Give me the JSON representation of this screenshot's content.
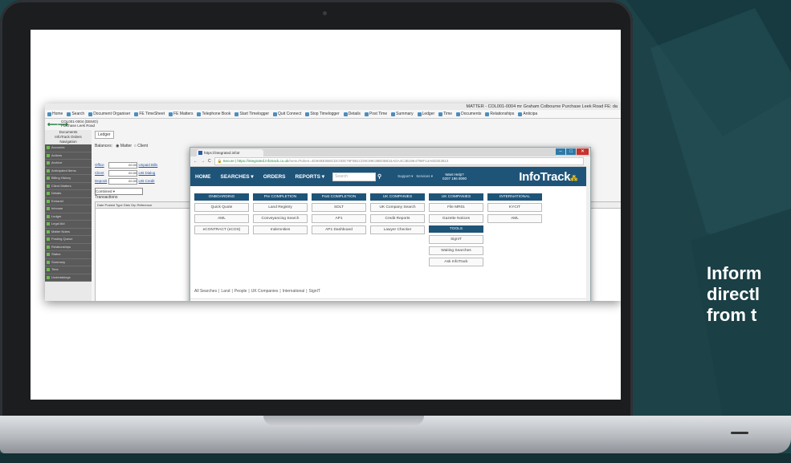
{
  "colors": {
    "background": "#1d4348",
    "infotrack_blue": "#1f5479",
    "laptop_bezel": "#1b1d1f"
  },
  "side_text": [
    "Inform",
    "directl",
    "from t"
  ],
  "app": {
    "title": "MATTER - COL001-0004 mr Graham Colbourne Purchase Leek Road FE: da",
    "toolbar": [
      "Home",
      "Search",
      "Document Organiser",
      "FE TimeSheet",
      "FE Matters",
      "Telephone Book",
      "Start Timelogger",
      "Quit Connect",
      "Stop Timelogger",
      "Details",
      "Post Time",
      "Summary",
      "Ledger",
      "Time",
      "Documents",
      "Relationships",
      "Anticipa"
    ],
    "matter_lines": [
      "COL001-0004 (DEMO)",
      "Purchase Leek Road"
    ],
    "leftnav_head": [
      "Documents",
      "InfoTrack Orders",
      "Navigation"
    ],
    "leftnav_items": [
      "Accounts",
      "Actions",
      "Archive",
      "Anticipated Items",
      "Billing History",
      "Client Matters",
      "Details",
      "Extranet",
      "Inhouse",
      "Ledger",
      "Legal Aid",
      "Matter Notes",
      "Posting Queue",
      "Relationships",
      "Status",
      "Summary",
      "Time",
      "Undertakings"
    ],
    "ledger_tab": "Ledger",
    "balances_label": "Balances:",
    "matter_radio": "Matter",
    "client_radio": "Client",
    "fields": [
      {
        "label": "Office",
        "value": "£0.00",
        "link": "Unpaid Bills"
      },
      {
        "label": "Client",
        "value": "£0.00",
        "link": "LIB Dialog"
      },
      {
        "label": "Deposit",
        "value": "£0.00",
        "link": "LIB Credit"
      }
    ],
    "combined": "Combined",
    "transactions": "Transactions",
    "trans_head": "Date Posted   Type   Disb Grp   Reference",
    "right_head": "Mtrfer"
  },
  "browser": {
    "tab_title": "https://integrated.infotr",
    "secure": "Secure",
    "url": "https://integrated.infotrack.co.uk",
    "url_rest": "/menu?token=4D94BE0B8CDC0DE79F0B1CD9C89C88E0B834ADA4C3B1964796F14A6D2E3814",
    "nav": {
      "home": "HOME",
      "searches": "SEARCHES",
      "orders": "ORDERS",
      "reports": "REPORTS",
      "search_placeholder": "Search",
      "support": "Support",
      "services": "Services",
      "help_line1": "Want Help?",
      "help_line2": "0207 186 8090",
      "logo": "InfoTrack"
    },
    "columns": [
      {
        "header": "ONBOARDING",
        "items": [
          "Quick Quote",
          "AML",
          "eCONTRACT (eCOS)"
        ]
      },
      {
        "header": "Pre COMPLETION",
        "items": [
          "Land Registry",
          "Conveyancing Search",
          "Indemnities"
        ]
      },
      {
        "header": "Post COMPLETION",
        "items": [
          "SDLT",
          "AP1",
          "AP1 Dashboard"
        ]
      },
      {
        "header": "UK COMPANIES",
        "items": [
          "UK Company Search",
          "Credit Reports",
          "Lawyer Checker"
        ]
      },
      {
        "header": "UK COMPANIES",
        "items": [
          "File MR01",
          "Gazette Notices"
        ],
        "sub_header": "TOOLS",
        "sub_items": [
          "SignIT",
          "Waiting Searches",
          "Ask InfoTrack"
        ]
      },
      {
        "header": "INTERNATIONAL",
        "items": [
          "KYCIT",
          "AML"
        ]
      }
    ],
    "bottom_tabs": [
      "All Searches",
      "Land",
      "People",
      "UK Companies",
      "International",
      "SignIT"
    ]
  }
}
